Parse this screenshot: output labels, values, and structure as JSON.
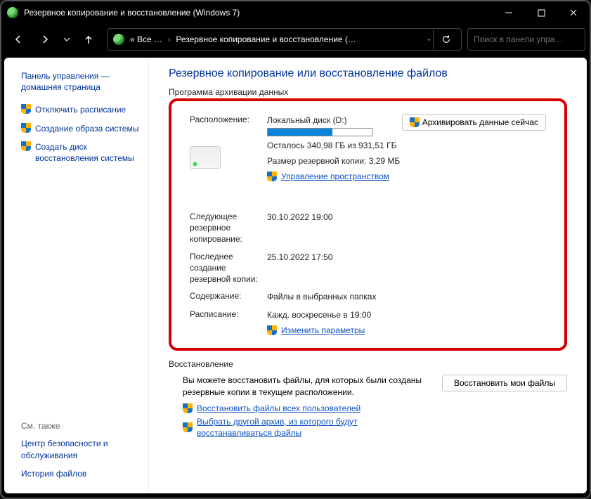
{
  "titlebar": {
    "title": "Резервное копирование и восстановление (Windows 7)"
  },
  "breadcrumb": {
    "root_short": "« Все …",
    "item2": "Резервное копирование и восстановление (…"
  },
  "search": {
    "placeholder": "Поиск в панели упра…"
  },
  "sidebar": {
    "home": "Панель управления — домашняя страница",
    "links": [
      "Отключить расписание",
      "Создание образа системы",
      "Создать диск восстановления системы"
    ],
    "footer_hdr": "См. также",
    "footer_links": [
      "Центр безопасности и обслуживания",
      "История файлов"
    ]
  },
  "main": {
    "page_title": "Резервное копирование или восстановление файлов",
    "section_archive": "Программа архивации данных",
    "location_label": "Расположение:",
    "location_value": "Локальный диск (D:)",
    "free_space": "Осталось 340,98 ГБ из 931,51 ГБ",
    "backup_size": "Размер резервной копии: 3,29 МБ",
    "manage_space": "Управление пространством",
    "backup_now_btn": "Архивировать данные сейчас",
    "next_label": "Следующее резервное копирование:",
    "next_value": "30.10.2022 19:00",
    "last_label": "Последнее создание резервной копии:",
    "last_value": "25.10.2022 17:50",
    "content_label": "Содержание:",
    "content_value": "Файлы в выбранных папках",
    "schedule_label": "Расписание:",
    "schedule_value": "Кажд. воскресенье в 19:00",
    "change_params": "Изменить параметры",
    "section_restore": "Восстановление",
    "restore_text": "Вы можете восстановить файлы, для которых были созданы резервные копии в текущем расположении.",
    "restore_all_users": "Восстановить файлы всех пользователей",
    "choose_other": "Выбрать другой архив, из которого будут восстанавливаться файлы",
    "restore_my_btn": "Восстановить мои файлы"
  }
}
